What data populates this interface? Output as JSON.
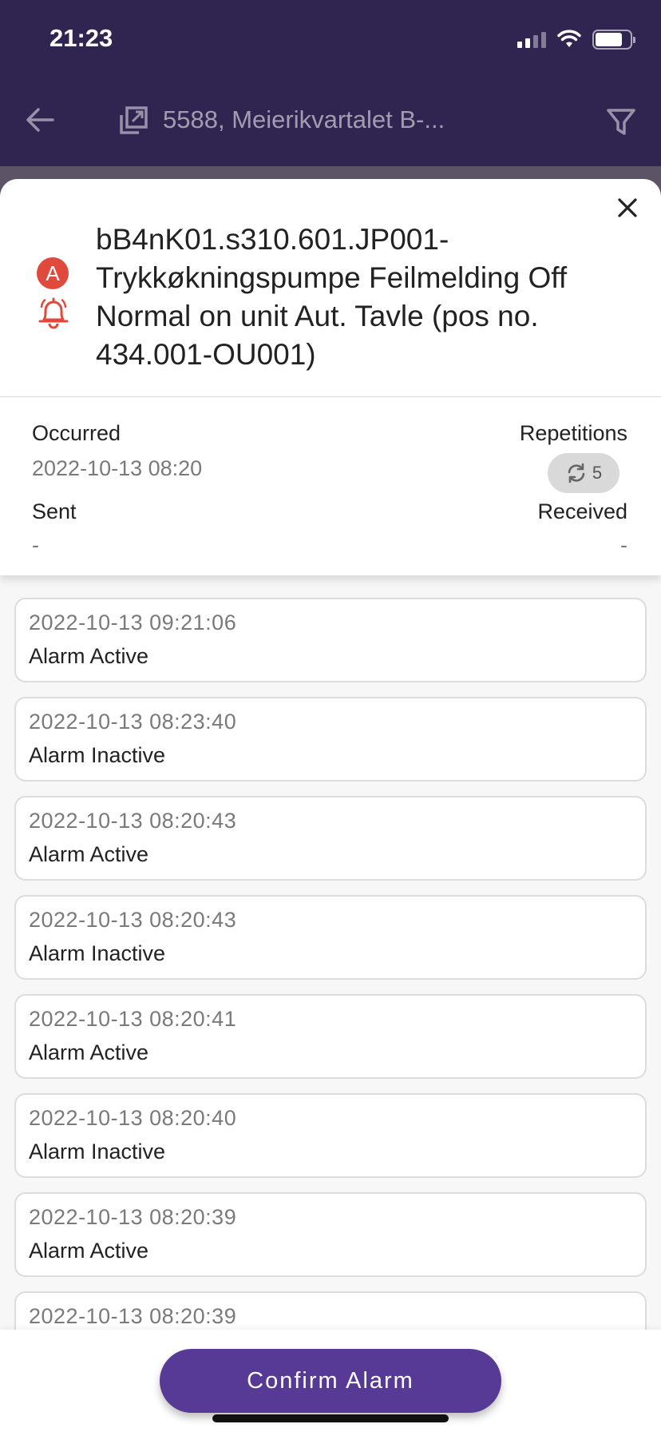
{
  "status_bar": {
    "time": "21:23"
  },
  "header": {
    "site_title": "5588, Meierikvartalet B-..."
  },
  "alarm": {
    "priority_badge": "A",
    "title": "bB4nK01.s310.601.JP001-Trykkøkningspumpe Feilmelding Off Normal on unit Aut. Tavle (pos no. 434.001-OU001)"
  },
  "info": {
    "occurred_label": "Occurred",
    "occurred_value": "2022-10-13 08:20",
    "repetitions_label": "Repetitions",
    "repetitions_count": "5",
    "sent_label": "Sent",
    "sent_value": "-",
    "received_label": "Received",
    "received_value": "-"
  },
  "events": [
    {
      "time": "2022-10-13 09:21:06",
      "status": "Alarm Active"
    },
    {
      "time": "2022-10-13 08:23:40",
      "status": "Alarm Inactive"
    },
    {
      "time": "2022-10-13 08:20:43",
      "status": "Alarm Active"
    },
    {
      "time": "2022-10-13 08:20:43",
      "status": "Alarm Inactive"
    },
    {
      "time": "2022-10-13 08:20:41",
      "status": "Alarm Active"
    },
    {
      "time": "2022-10-13 08:20:40",
      "status": "Alarm Inactive"
    },
    {
      "time": "2022-10-13 08:20:39",
      "status": "Alarm Active"
    },
    {
      "time": "2022-10-13 08:20:39",
      "status": ""
    }
  ],
  "actions": {
    "confirm_label": "Confirm Alarm"
  },
  "colors": {
    "header_bg": "#2f2550",
    "accent": "#573a95",
    "alarm_red": "#e04a3c"
  }
}
